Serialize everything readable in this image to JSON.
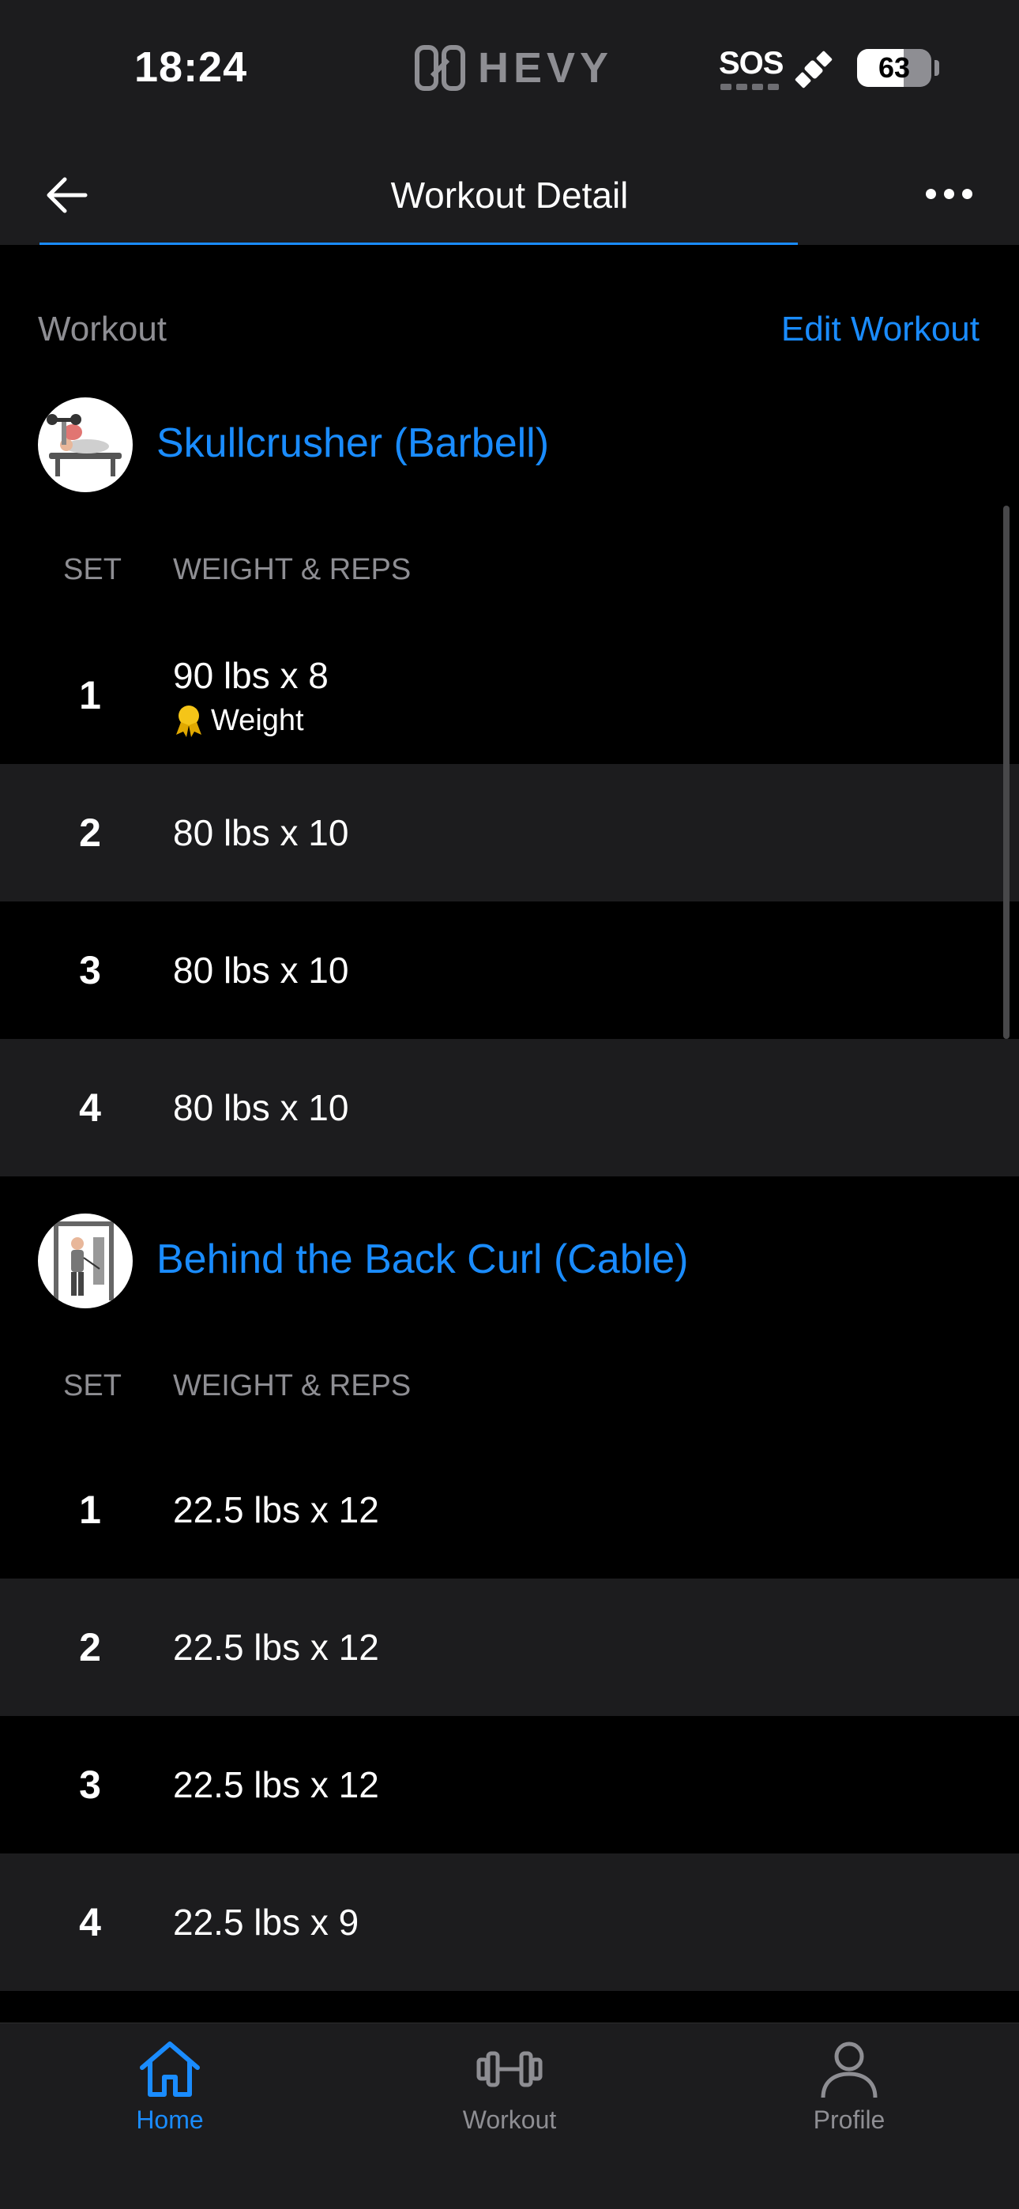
{
  "status_bar": {
    "time": "18:24",
    "brand": "HEVY",
    "sos": "SOS",
    "battery_percent": 63,
    "battery_label": "63"
  },
  "header": {
    "title": "Workout Detail",
    "back_icon": "arrow-left-icon",
    "more_icon": "ellipsis-icon"
  },
  "workout": {
    "section_label": "Workout",
    "edit_label": "Edit Workout",
    "exercises": [
      {
        "name": "Skullcrusher (Barbell)",
        "set_header": "SET",
        "weight_header": "WEIGHT & REPS",
        "sets": [
          {
            "set": "1",
            "value": "90 lbs x 8",
            "badge": "Weight"
          },
          {
            "set": "2",
            "value": "80 lbs x 10"
          },
          {
            "set": "3",
            "value": "80 lbs x 10"
          },
          {
            "set": "4",
            "value": "80 lbs x 10"
          }
        ]
      },
      {
        "name": "Behind the Back Curl (Cable)",
        "set_header": "SET",
        "weight_header": "WEIGHT & REPS",
        "sets": [
          {
            "set": "1",
            "value": "22.5 lbs x 12"
          },
          {
            "set": "2",
            "value": "22.5 lbs x 12"
          },
          {
            "set": "3",
            "value": "22.5 lbs x 12"
          },
          {
            "set": "4",
            "value": "22.5 lbs x 9"
          }
        ]
      }
    ]
  },
  "tabbar": {
    "tabs": [
      {
        "label": "Home",
        "icon": "home-icon",
        "active": true
      },
      {
        "label": "Workout",
        "icon": "dumbbell-icon",
        "active": false
      },
      {
        "label": "Profile",
        "icon": "person-icon",
        "active": false
      }
    ]
  },
  "colors": {
    "accent": "#1a8cff",
    "gold": "#f5c518",
    "row_alt": "#1c1c1e"
  }
}
